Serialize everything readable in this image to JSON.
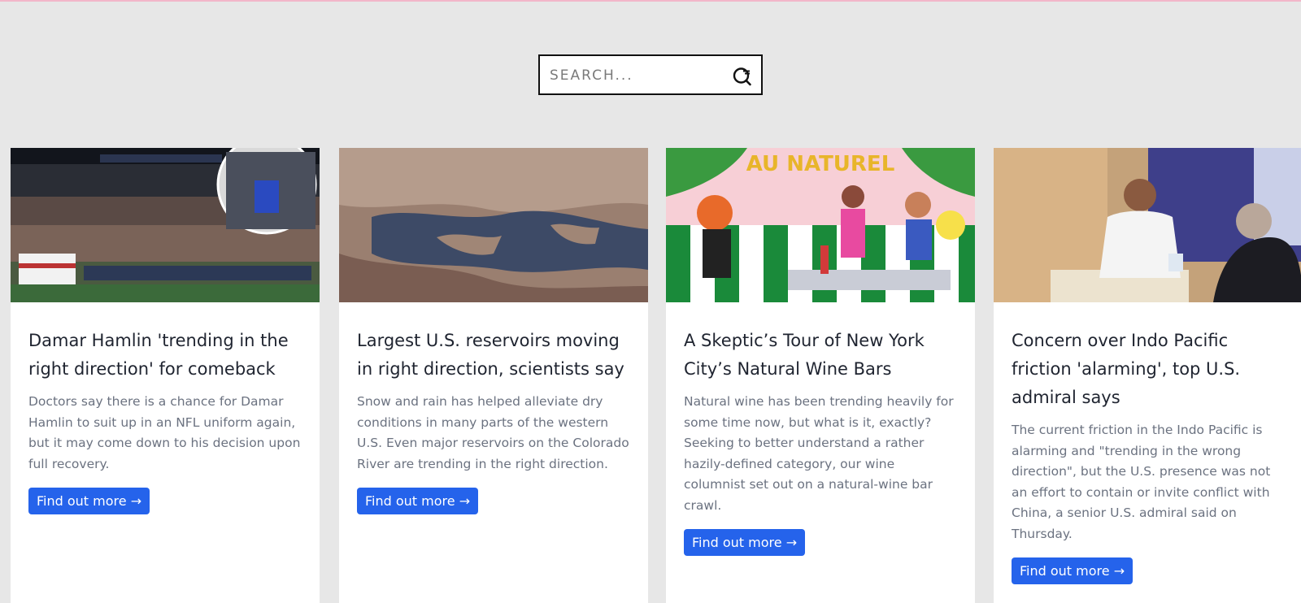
{
  "search": {
    "placeholder": "SEARCH..."
  },
  "cards": [
    {
      "title": "Damar Hamlin 'trending in the right direction' for comeback",
      "text": "Doctors say there is a chance for Damar Hamlin to suit up in an NFL uniform again, but it may come down to his decision upon full recovery.",
      "button": "Find out more →",
      "image": "football-stadium-photo"
    },
    {
      "title": "Largest U.S. reservoirs moving in right direction, scientists say",
      "text": "Snow and rain has helped alleviate dry conditions in many parts of the western U.S. Even major reservoirs on the Colorado River are trending in the right direction.",
      "button": "Find out more →",
      "image": "reservoir-aerial-photo"
    },
    {
      "title": "A Skeptic’s Tour of New York City’s Natural Wine Bars",
      "text": "Natural wine has been trending heavily for some time now, but what is it, exactly? Seeking to better understand a rather hazily-defined category, our wine columnist set out on a natural-wine bar crawl.",
      "button": "Find out more →",
      "image": "wine-bar-illustration",
      "image_sign": "AU NATUREL"
    },
    {
      "title": "Concern over Indo Pacific friction 'alarming', top U.S. admiral says",
      "text": "The current friction in the Indo Pacific is alarming and \"trending in the wrong direction\", but the U.S. presence was not an effort to contain or invite conflict with China, a senior U.S. admiral said on Thursday.",
      "button": "Find out more →",
      "image": "admiral-panel-photo"
    }
  ]
}
